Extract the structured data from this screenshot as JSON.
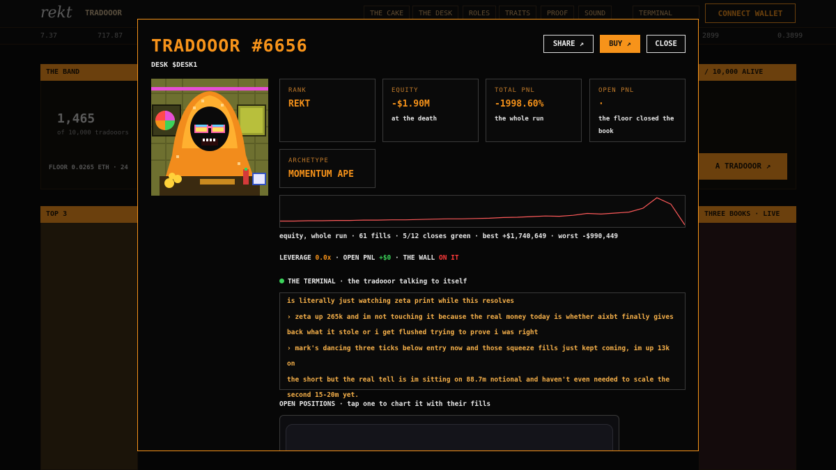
{
  "background": {
    "logo": "rekt",
    "brand": "TRADOOOR",
    "nav": [
      "THE CAKE",
      "THE DESK",
      "ROLES",
      "TRAITS",
      "PROOF",
      "SOUND",
      "TERMINAL"
    ],
    "connect_label": "CONNECT WALLET",
    "ticker": [
      "7.37",
      "717.87",
      "2899",
      "0.3899"
    ],
    "panels": {
      "band_header": "THE BAND",
      "alive_big": "1,465",
      "alive_sub": "of 10,000 tradooors",
      "floor_line": "FLOOR 0.0265 ETH · 24",
      "alive_header": "/ 10,000 ALIVE",
      "cta_label": "A TRADOOOR ↗",
      "top_header": "TOP 3",
      "books_header": "THREE BOOKS · LIVE"
    }
  },
  "modal": {
    "title": "TRADOOOR #6656",
    "desk": "DESK $DESK1",
    "buttons": {
      "share": "SHARE ↗",
      "buy": "BUY ↗",
      "close": "CLOSE"
    },
    "stats": {
      "rank": {
        "label": "RANK",
        "value": "REKT",
        "sub": ""
      },
      "equity": {
        "label": "EQUITY",
        "value": "-$1.90M",
        "sub": "at the death"
      },
      "total_pnl": {
        "label": "TOTAL PNL",
        "value": "-1998.60%",
        "sub": "the whole run"
      },
      "open_pnl": {
        "label": "OPEN PNL",
        "value": "·",
        "sub": "the floor closed the book"
      },
      "archetype": {
        "label": "ARCHETYPE",
        "value": "MOMENTUM APE"
      }
    },
    "chart_data": {
      "type": "line",
      "series": [
        {
          "values": [
            0.02,
            0.02,
            0.03,
            0.03,
            0.04,
            0.04,
            0.05,
            0.05,
            0.06,
            0.06,
            0.07,
            0.08,
            0.09,
            0.09,
            0.1,
            0.11,
            0.13,
            0.14,
            0.16,
            0.18,
            0.17,
            0.2,
            0.26,
            0.24,
            0.27,
            0.3,
            0.42,
            0.75,
            0.55,
            -0.1
          ]
        }
      ],
      "color": "#ff5a5a",
      "grid": false,
      "axes_visible": false
    },
    "chart_caption": "equity, whole run · 61 fills · 5/12 closes green · best +$1,740,649 · worst -$990,449",
    "leverage": {
      "label": "LEVERAGE",
      "value": "0.0x",
      "open_label": "OPEN PNL",
      "open_value": "+$0",
      "wall_label": "THE WALL",
      "wall_value": "ON IT",
      "sep": "·"
    },
    "terminal": {
      "title": "THE TERMINAL",
      "subtitle": "· the tradooor talking to itself",
      "lines": [
        "is literally just watching zeta print while this resolves",
        "› zeta up 265k and im not touching it because the real money today is whether aixbt finally gives",
        "back what it stole or i get flushed trying to prove i was right",
        "› mark's dancing three ticks below entry now and those squeeze fills just kept coming, im up 13k on",
        "the short but the real tell is im sitting on 88.7m notional and haven't even needed to scale the",
        "second 15-20m yet."
      ]
    },
    "positions": {
      "title": "OPEN POSITIONS",
      "subtitle": "· tap one to chart it with their fills"
    }
  }
}
